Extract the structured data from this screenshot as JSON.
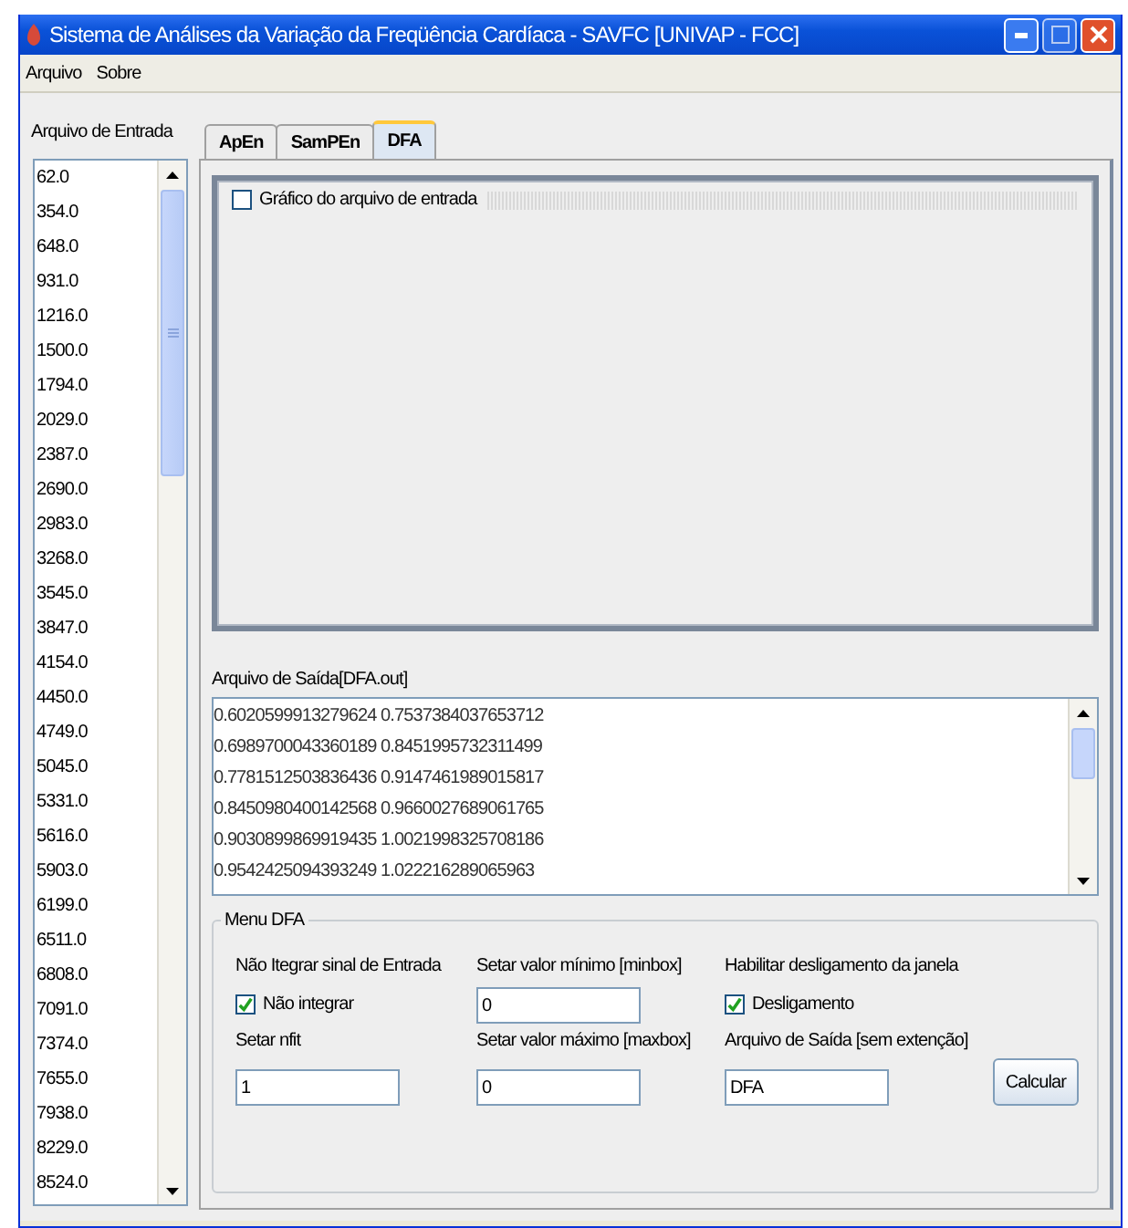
{
  "window": {
    "title": "Sistema de Análises da Variação da Freqüência Cardíaca - SAVFC  [UNIVAP - FCC]"
  },
  "menu": [
    "Arquivo",
    "Sobre"
  ],
  "input_panel": {
    "label": "Arquivo de Entrada",
    "items": [
      "62.0",
      "354.0",
      "648.0",
      "931.0",
      "1216.0",
      "1500.0",
      "1794.0",
      "2029.0",
      "2387.0",
      "2690.0",
      "2983.0",
      "3268.0",
      "3545.0",
      "3847.0",
      "4154.0",
      "4450.0",
      "4749.0",
      "5045.0",
      "5331.0",
      "5616.0",
      "5903.0",
      "6199.0",
      "6511.0",
      "6808.0",
      "7091.0",
      "7374.0",
      "7655.0",
      "7938.0",
      "8229.0",
      "8524.0"
    ]
  },
  "tabs": [
    {
      "label": "ApEn",
      "selected": false
    },
    {
      "label": "SamPEn",
      "selected": false
    },
    {
      "label": "DFA",
      "selected": true
    }
  ],
  "graph": {
    "title": "Gráfico do arquivo de entrada",
    "checked": false
  },
  "output": {
    "label": "Arquivo de Saída[DFA.out]",
    "lines": [
      "0.6020599913279624 0.7537384037653712",
      "0.6989700043360189 0.8451995732311499",
      "0.7781512503836436 0.9147461989015817",
      "0.8450980400142568 0.9660027689061765",
      "0.9030899869919435 1.0021998325708186",
      "0.9542425094393249 1.022216289065963"
    ]
  },
  "menu_dfa": {
    "title": "Menu DFA",
    "no_integrate_label": "Não Itegrar sinal de Entrada",
    "no_integrate": {
      "label": "Não integrar",
      "checked": true
    },
    "nfit_label": "Setar nfit",
    "nfit": "1",
    "min_label": "Setar valor mínimo [minbox]",
    "min": "0",
    "max_label": "Setar valor máximo [maxbox]",
    "max": "0",
    "shutdown_label": "Habilitar desligamento da janela",
    "shutdown": {
      "label": "Desligamento",
      "checked": true
    },
    "outfile_label": "Arquivo de Saída [sem extenção]",
    "outfile": "DFA",
    "button": "Calcular"
  }
}
